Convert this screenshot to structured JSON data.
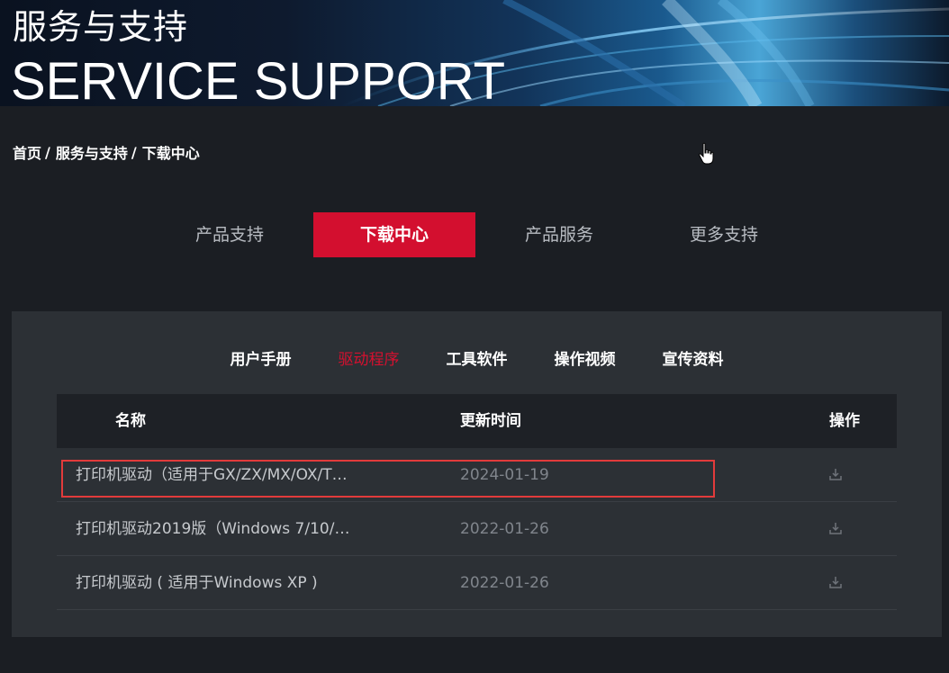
{
  "banner": {
    "title_cn": "服务与支持",
    "title_en": "SERVICE SUPPORT"
  },
  "breadcrumb": {
    "items": [
      "首页",
      "服务与支持",
      "下载中心"
    ],
    "separator": "/"
  },
  "main_tabs": [
    {
      "label": "产品支持",
      "active": false
    },
    {
      "label": "下载中心",
      "active": true
    },
    {
      "label": "产品服务",
      "active": false
    },
    {
      "label": "更多支持",
      "active": false
    }
  ],
  "sub_tabs": [
    {
      "label": "用户手册",
      "active": false
    },
    {
      "label": "驱动程序",
      "active": true
    },
    {
      "label": "工具软件",
      "active": false
    },
    {
      "label": "操作视频",
      "active": false
    },
    {
      "label": "宣传资料",
      "active": false
    }
  ],
  "table": {
    "headers": {
      "name": "名称",
      "date": "更新时间",
      "op": "操作"
    },
    "rows": [
      {
        "name": "打印机驱动（适用于GX/ZX/MX/OX/T…",
        "date": "2024-01-19",
        "action_icon": "download-icon",
        "highlighted": true
      },
      {
        "name": "打印机驱动2019版（Windows 7/10/…",
        "date": "2022-01-26",
        "action_icon": "download-icon",
        "highlighted": false
      },
      {
        "name": "打印机驱动 ( 适用于Windows XP )",
        "date": "2022-01-26",
        "action_icon": "download-icon",
        "highlighted": false
      }
    ]
  },
  "colors": {
    "accent": "#d30f2f",
    "page_bg": "#1b1e23",
    "panel_bg": "#2c3035",
    "table_head_bg": "#1e2126",
    "highlight_border": "#e23b3b"
  },
  "icons": {
    "cursor": "hand-pointer-icon",
    "download": "download-icon"
  }
}
